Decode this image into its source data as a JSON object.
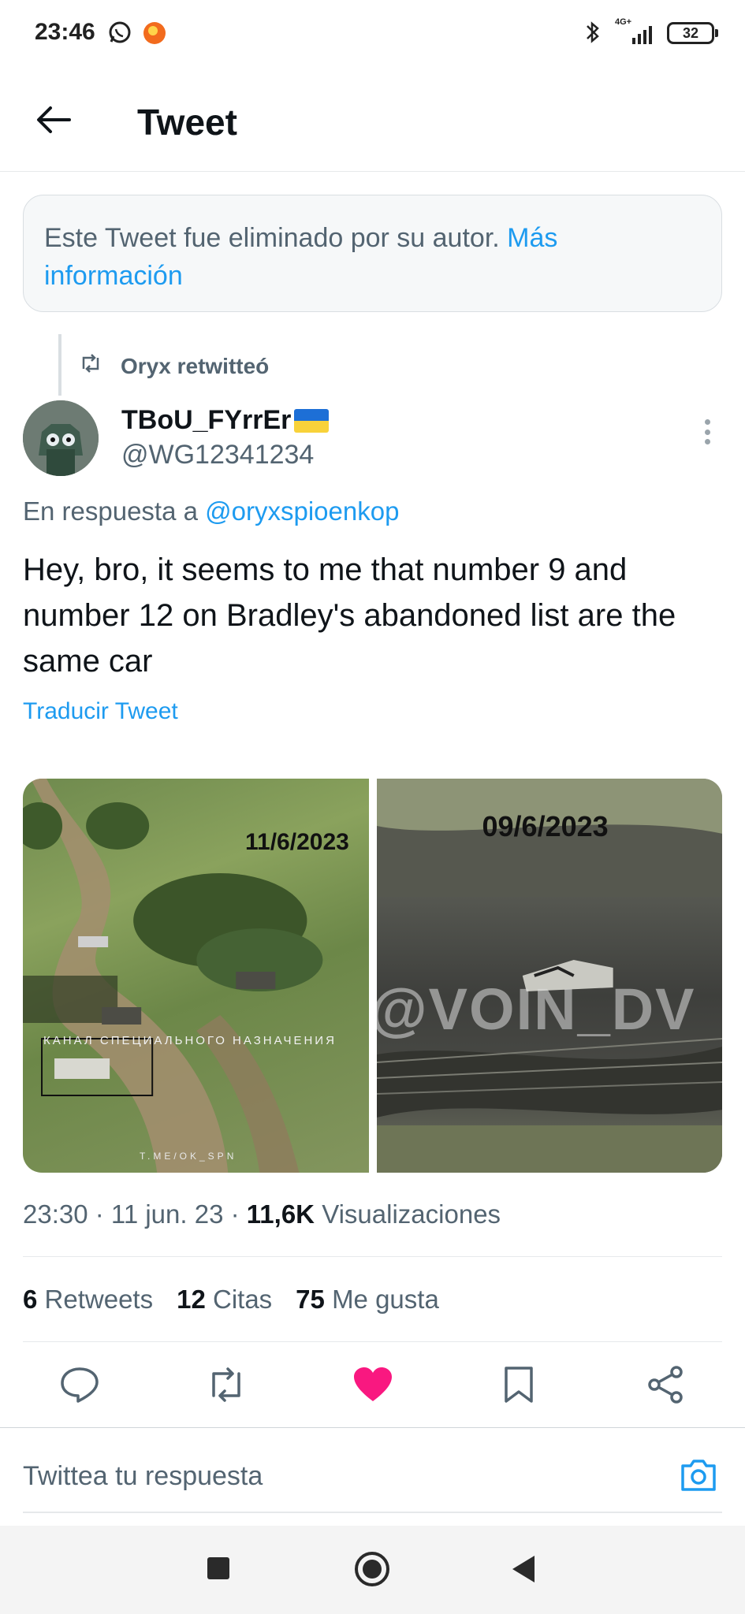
{
  "status_bar": {
    "time": "23:46",
    "network": "4G+",
    "battery": "32"
  },
  "header": {
    "title": "Tweet"
  },
  "notice": {
    "text": "Este Tweet fue eliminado por su autor.",
    "link": "Más información"
  },
  "retweet": {
    "label": "Oryx retwitteó"
  },
  "author": {
    "name": "TBoU_FYrrEr",
    "handle": "@WG12341234"
  },
  "reply_to": {
    "prefix": "En respuesta a",
    "handle": "@oryxspioenkop"
  },
  "tweet": {
    "text": "Hey, bro, it seems to me that number 9 and number 12 on Bradley's abandoned list are the same car",
    "translate_label": "Traducir Tweet"
  },
  "media": {
    "image1": {
      "date": "11/6/2023",
      "caption": "КАНАЛ СПЕЦИАЛЬНОГО НАЗНАЧЕНИЯ",
      "url": "T.ME/OK_SPN"
    },
    "image2": {
      "date": "09/6/2023",
      "watermark": "@VOIN_DV"
    }
  },
  "meta": {
    "time": "23:30",
    "date": "11 jun. 23",
    "views_count": "11,6K",
    "views_label": "Visualizaciones"
  },
  "stats": {
    "retweets_count": "6",
    "retweets_label": "Retweets",
    "quotes_count": "12",
    "quotes_label": "Citas",
    "likes_count": "75",
    "likes_label": "Me gusta"
  },
  "reply_box": {
    "placeholder": "Twittea tu respuesta"
  },
  "colors": {
    "accent": "#1d9bf0",
    "like": "#f91880",
    "text_secondary": "#536471"
  }
}
